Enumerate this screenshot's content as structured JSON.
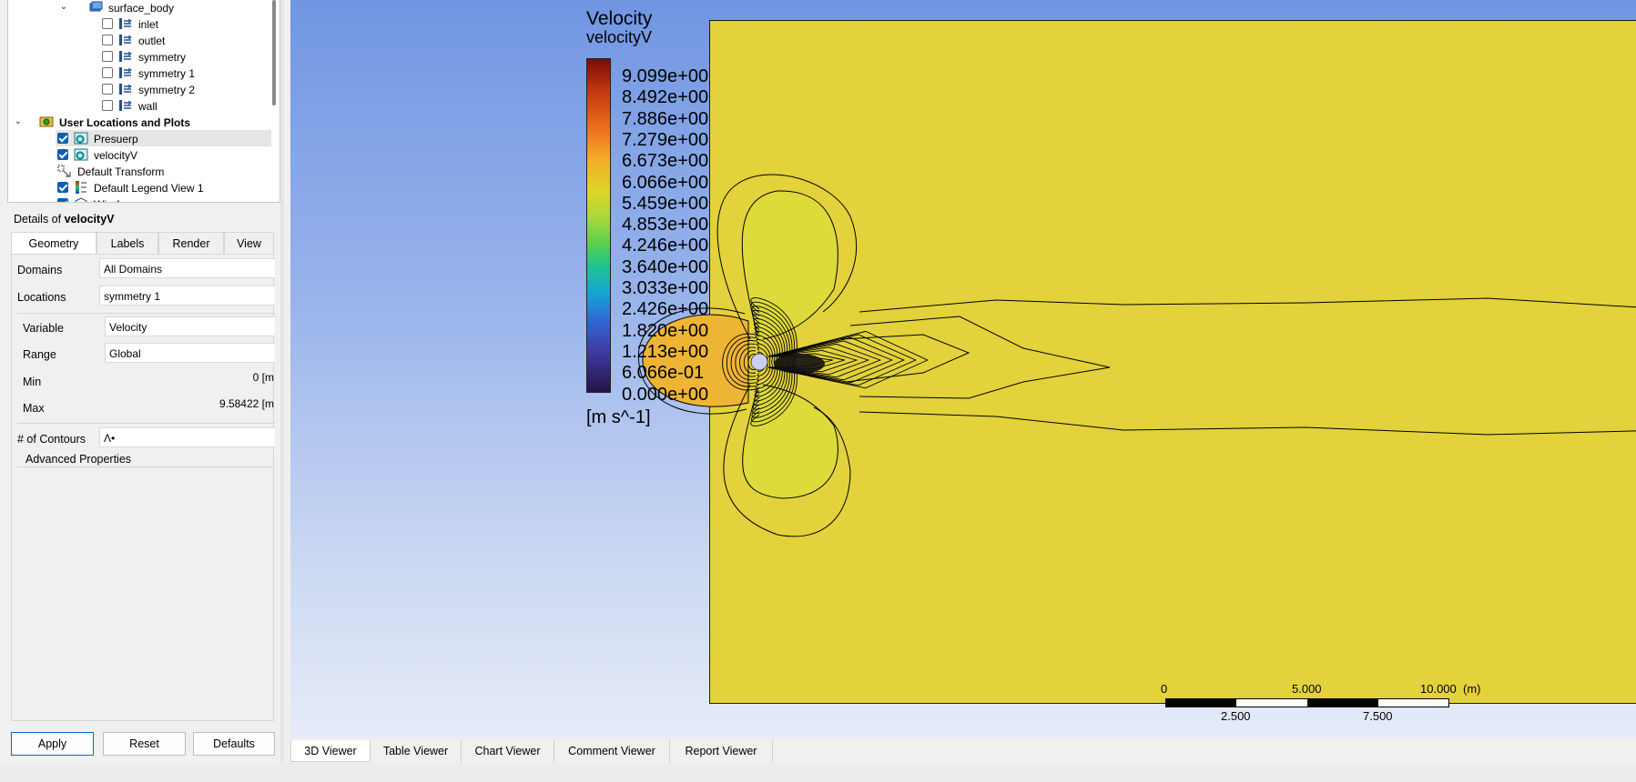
{
  "tree": {
    "items": [
      {
        "label": "surface_body",
        "bold": false,
        "checkbox": "none",
        "chevron": true,
        "icon": "surface-body-icon"
      },
      {
        "label": "inlet",
        "bold": false,
        "checkbox": "off",
        "chevron": false,
        "icon": "boundary-icon"
      },
      {
        "label": "outlet",
        "bold": false,
        "checkbox": "off",
        "chevron": false,
        "icon": "boundary-icon"
      },
      {
        "label": "symmetry",
        "bold": false,
        "checkbox": "off",
        "chevron": false,
        "icon": "boundary-icon"
      },
      {
        "label": "symmetry 1",
        "bold": false,
        "checkbox": "off",
        "chevron": false,
        "icon": "boundary-icon"
      },
      {
        "label": "symmetry 2",
        "bold": false,
        "checkbox": "off",
        "chevron": false,
        "icon": "boundary-icon"
      },
      {
        "label": "wall",
        "bold": false,
        "checkbox": "off",
        "chevron": false,
        "icon": "boundary-icon"
      },
      {
        "label": "User Locations and Plots",
        "bold": true,
        "checkbox": "none",
        "chevron": true,
        "icon": "user-locations-icon"
      },
      {
        "label": "Presuerp",
        "bold": false,
        "checkbox": "on",
        "chevron": false,
        "icon": "contour-icon",
        "selected": true
      },
      {
        "label": "velocityV",
        "bold": false,
        "checkbox": "on",
        "chevron": false,
        "icon": "contour-icon"
      },
      {
        "label": "Default Transform",
        "bold": false,
        "checkbox": "none",
        "chevron": false,
        "icon": "transform-icon"
      },
      {
        "label": "Default Legend View 1",
        "bold": false,
        "checkbox": "on",
        "chevron": false,
        "icon": "legend-icon"
      },
      {
        "label": "Wireframe",
        "bold": false,
        "checkbox": "on",
        "chevron": false,
        "icon": "wireframe-icon"
      }
    ]
  },
  "details": {
    "prefix": "Details of ",
    "object": "velocityV",
    "tabs": [
      "Geometry",
      "Labels",
      "Render",
      "View"
    ],
    "active_tab": "Geometry",
    "domains_label": "Domains",
    "domains_value": "All Domains",
    "locations_label": "Locations",
    "locations_value": "symmetry 1",
    "variable_label": "Variable",
    "variable_value": "Velocity",
    "range_label": "Range",
    "range_value": "Global",
    "min_label": "Min",
    "min_value": "0 [m",
    "max_label": "Max",
    "max_value": "9.58422 [m",
    "contours_label": "# of Contours",
    "contours_value": "Λ•",
    "advanced_label": "Advanced Properties"
  },
  "buttons": {
    "apply": "Apply",
    "reset": "Reset",
    "defaults": "Defaults"
  },
  "legend": {
    "title": "Velocity",
    "subtitle": "velocityV",
    "ticks": [
      "9.099e+00",
      "8.492e+00",
      "7.886e+00",
      "7.279e+00",
      "6.673e+00",
      "6.066e+00",
      "5.459e+00",
      "4.853e+00",
      "4.246e+00",
      "3.640e+00",
      "3.033e+00",
      "2.426e+00",
      "1.820e+00",
      "1.213e+00",
      "6.066e-01",
      "0.000e+00"
    ],
    "units": "[m s^-1]"
  },
  "scale": {
    "top_labels": [
      "0",
      "5.000",
      "10.000"
    ],
    "unit": "(m)",
    "bottom_labels": [
      "2.500",
      "7.500"
    ]
  },
  "viewer_tabs": [
    "3D Viewer",
    "Table Viewer",
    "Chart Viewer",
    "Comment Viewer",
    "Report Viewer"
  ],
  "active_viewer_tab": "3D Viewer",
  "colors": {
    "domain_fill": "#e3d23b",
    "inner_lobe": "#dcdb3a",
    "upstream_lobe": "#eeb535",
    "accent_blue": "#0a5fb4"
  }
}
